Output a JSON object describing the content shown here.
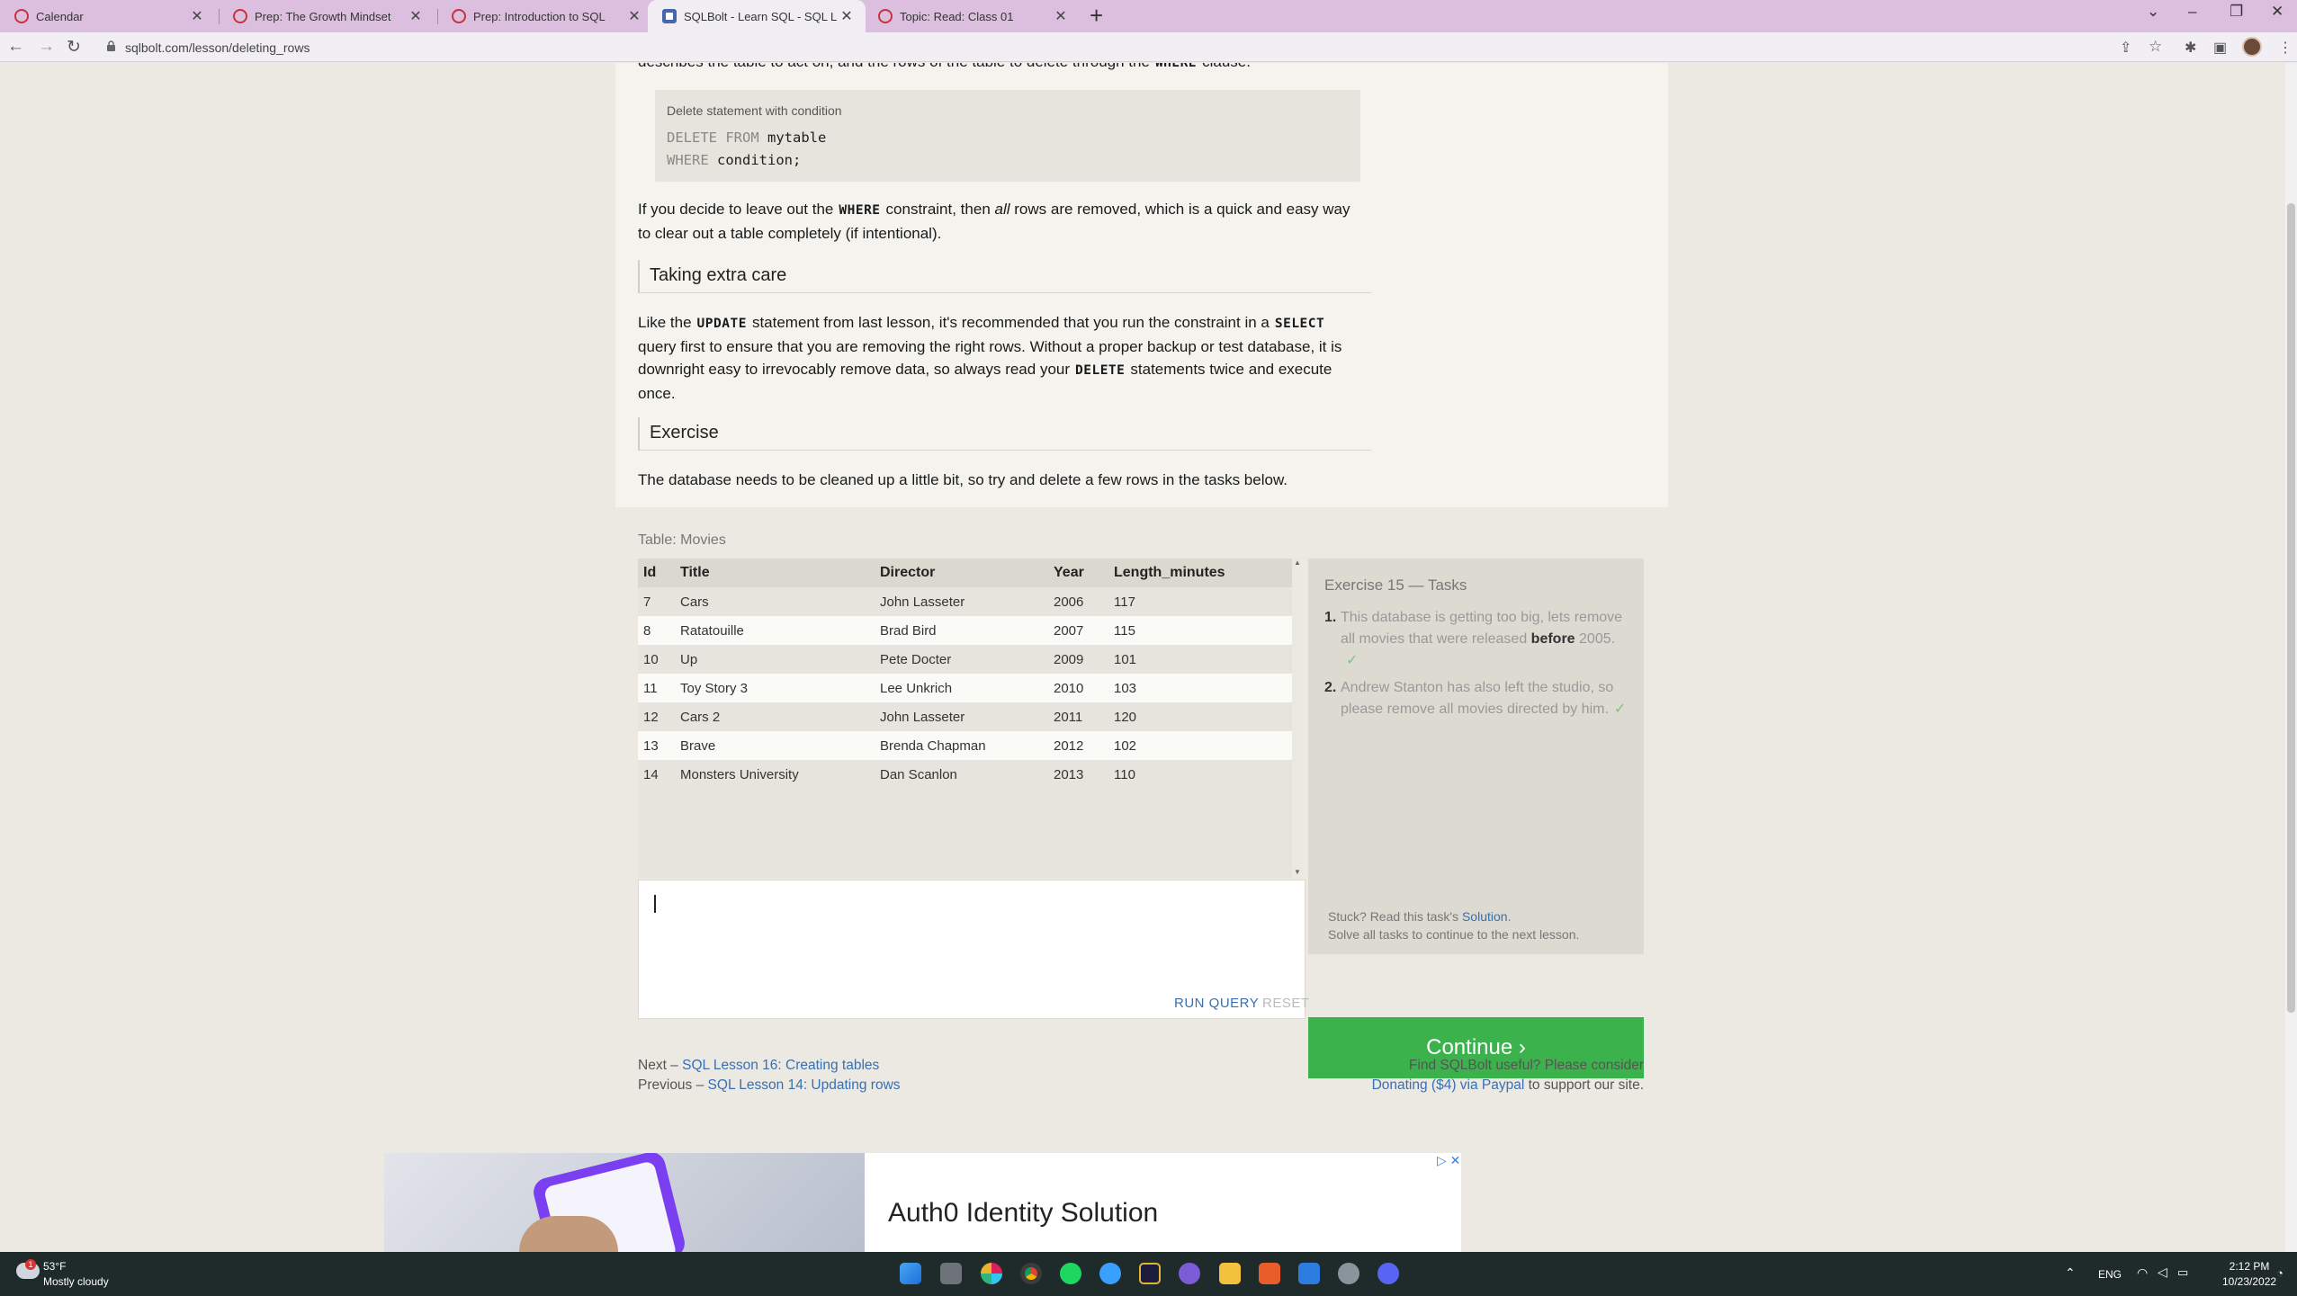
{
  "browser": {
    "tabs": [
      {
        "label": "Calendar",
        "icon": "calendar-favicon"
      },
      {
        "label": "Prep: The Growth Mindset",
        "icon": "ring-favicon"
      },
      {
        "label": "Prep: Introduction to SQL",
        "icon": "ring-favicon"
      },
      {
        "label": "SQLBolt - Learn SQL - SQL Lesso",
        "icon": "sqlbolt-favicon",
        "active": true
      },
      {
        "label": "Topic: Read: Class 01",
        "icon": "ring-favicon"
      }
    ],
    "url": "sqlbolt.com/lesson/deleting_rows"
  },
  "lesson": {
    "intro_tail": {
      "pre": "describes the table to act on, and the rows of the table to delete through the",
      "kw": "WHERE",
      "post": "clause."
    },
    "code_caption": "Delete statement with condition",
    "code_line1": {
      "k": "DELETE FROM",
      "v": "mytable"
    },
    "code_line2": {
      "k": "WHERE",
      "v": "condition;"
    },
    "para1": {
      "a": "If you decide to leave out the",
      "kw": "WHERE",
      "b": "constraint, then",
      "em": "all",
      "c": "rows are removed, which is a quick and easy way",
      "d": "to clear out a table completely (if intentional)."
    },
    "h_care": "Taking extra care",
    "para2": {
      "a": "Like the",
      "kw1": "UPDATE",
      "b": "statement from last lesson, it's recommended that you run the constraint in a",
      "kw2": "SELECT",
      "c": "query first to ensure that you are removing the right rows. Without a proper backup or test database, it is",
      "d": "downright easy to irrevocably remove data, so always read your",
      "kw3": "DELETE",
      "e": "statements twice and execute",
      "f": "once."
    },
    "h_exercise": "Exercise",
    "para3": "The database needs to be cleaned up a little bit, so try and delete a few rows in the tasks below."
  },
  "exercise": {
    "table_caption": "Table: Movies",
    "columns": [
      "Id",
      "Title",
      "Director",
      "Year",
      "Length_minutes"
    ],
    "rows": [
      [
        "7",
        "Cars",
        "John Lasseter",
        "2006",
        "117"
      ],
      [
        "8",
        "Ratatouille",
        "Brad Bird",
        "2007",
        "115"
      ],
      [
        "10",
        "Up",
        "Pete Docter",
        "2009",
        "101"
      ],
      [
        "11",
        "Toy Story 3",
        "Lee Unkrich",
        "2010",
        "103"
      ],
      [
        "12",
        "Cars 2",
        "John Lasseter",
        "2011",
        "120"
      ],
      [
        "13",
        "Brave",
        "Brenda Chapman",
        "2012",
        "102"
      ],
      [
        "14",
        "Monsters University",
        "Dan Scanlon",
        "2013",
        "110"
      ]
    ],
    "editor_value": "",
    "run_query": "RUN QUERY",
    "reset": "RESET",
    "task_title": "Exercise 15 — Tasks",
    "task1": {
      "n": "1.",
      "a": "This database is getting too big, lets remove all movies that were released",
      "b": "before",
      "c": "2005.",
      "check": "✓"
    },
    "task2": {
      "n": "2.",
      "a": "Andrew Stanton has also left the studio, so please remove all movies directed by him.",
      "check": "✓"
    },
    "stuck": "Stuck? Read this task's",
    "solution": "Solution",
    "stuck_end": ".",
    "solve_all": "Solve all tasks to continue to the next lesson.",
    "continue": "Continue ›"
  },
  "footer": {
    "next_label": "Next –",
    "next_link": "SQL Lesson 16: Creating tables",
    "prev_label": "Previous –",
    "prev_link": "SQL Lesson 14: Updating rows",
    "find": "Find SQLBolt useful? Please consider",
    "donate": "Donating ($4) via Paypal",
    "support": "to support our site."
  },
  "ad": {
    "title": "Auth0 Identity Solution",
    "adchoices": "▷ ✕"
  },
  "taskbar": {
    "temp": "53°F",
    "weather": "Mostly cloudy",
    "badge": "1",
    "lang": "ENG",
    "time": "2:12 PM",
    "date": "10/23/2022"
  },
  "colors": {
    "accent": "#3cb24c",
    "link": "#3a6fb0",
    "tabbar": "#dcbfde"
  }
}
